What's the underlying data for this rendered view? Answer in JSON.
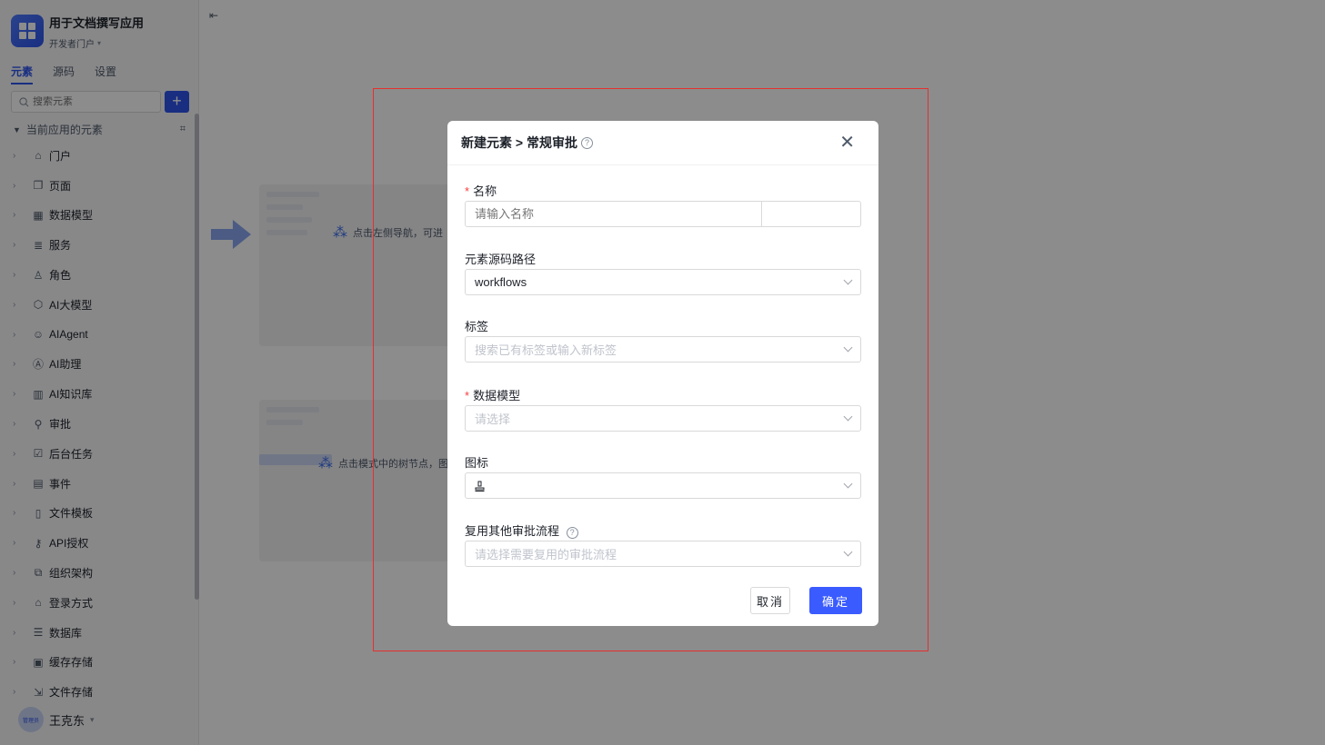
{
  "app": {
    "title": "用于文档撰写应用",
    "portal": "开发者门户"
  },
  "tabs": [
    "元素",
    "源码",
    "设置"
  ],
  "search": {
    "placeholder": "搜索元素"
  },
  "section": {
    "title": "当前应用的元素"
  },
  "nav": [
    {
      "label": "门户",
      "icon": "home-icon"
    },
    {
      "label": "页面",
      "icon": "page-icon"
    },
    {
      "label": "数据模型",
      "icon": "table-icon"
    },
    {
      "label": "服务",
      "icon": "service-icon"
    },
    {
      "label": "角色",
      "icon": "role-icon"
    },
    {
      "label": "AI大模型",
      "icon": "model-icon"
    },
    {
      "label": "AIAgent",
      "icon": "robot-icon"
    },
    {
      "label": "AI助理",
      "icon": "assistant-icon"
    },
    {
      "label": "AI知识库",
      "icon": "book-icon"
    },
    {
      "label": "审批",
      "icon": "stamp-icon"
    },
    {
      "label": "后台任务",
      "icon": "task-icon"
    },
    {
      "label": "事件",
      "icon": "event-icon"
    },
    {
      "label": "文件模板",
      "icon": "template-icon"
    },
    {
      "label": "API授权",
      "icon": "key-icon"
    },
    {
      "label": "组织架构",
      "icon": "org-icon"
    },
    {
      "label": "登录方式",
      "icon": "login-icon"
    },
    {
      "label": "数据库",
      "icon": "database-icon"
    },
    {
      "label": "缓存存储",
      "icon": "cache-icon"
    },
    {
      "label": "文件存储",
      "icon": "file-storage-icon"
    }
  ],
  "user": {
    "name": "王克东",
    "badge": "管理员"
  },
  "background": {
    "hint1": "点击左侧导航，可进",
    "hint2": "点击模式中的树节点，图"
  },
  "modal": {
    "title": "新建元素 > 常规审批",
    "name": {
      "label": "名称",
      "placeholder": "请输入名称"
    },
    "path": {
      "label": "元素源码路径",
      "value": "workflows"
    },
    "tags": {
      "label": "标签",
      "placeholder": "搜索已有标签或输入新标签"
    },
    "model": {
      "label": "数据模型",
      "placeholder": "请选择"
    },
    "icon": {
      "label": "图标",
      "value": "stamp-icon"
    },
    "reuse": {
      "label": "复用其他审批流程",
      "placeholder": "请选择需要复用的审批流程"
    },
    "cancel": "取消",
    "ok": "确定"
  },
  "colors": {
    "primary": "#3a5bff",
    "required": "#f53f3f",
    "highlight_border": "#e5302f"
  }
}
